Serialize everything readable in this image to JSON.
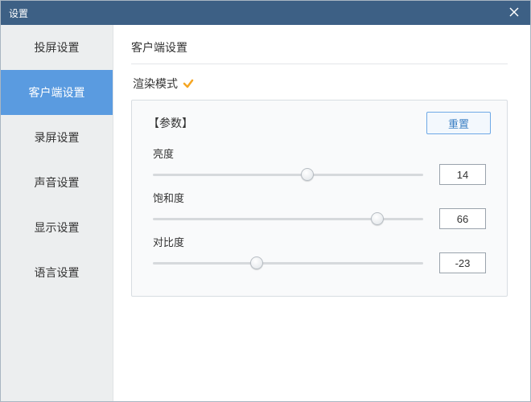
{
  "window": {
    "title": "设置"
  },
  "sidebar": {
    "items": [
      {
        "label": "投屏设置",
        "active": false
      },
      {
        "label": "客户端设置",
        "active": true
      },
      {
        "label": "录屏设置",
        "active": false
      },
      {
        "label": "声音设置",
        "active": false
      },
      {
        "label": "显示设置",
        "active": false
      },
      {
        "label": "语言设置",
        "active": false
      }
    ]
  },
  "main": {
    "page_title": "客户端设置",
    "section_label": "渲染模式",
    "panel": {
      "header_label": "【参数】",
      "reset_label": "重置",
      "params": [
        {
          "label": "亮度",
          "value": "14",
          "min": -100,
          "max": 100,
          "percent": 57
        },
        {
          "label": "饱和度",
          "value": "66",
          "min": -100,
          "max": 100,
          "percent": 83
        },
        {
          "label": "对比度",
          "value": "-23",
          "min": -100,
          "max": 100,
          "percent": 38.5
        }
      ]
    }
  }
}
